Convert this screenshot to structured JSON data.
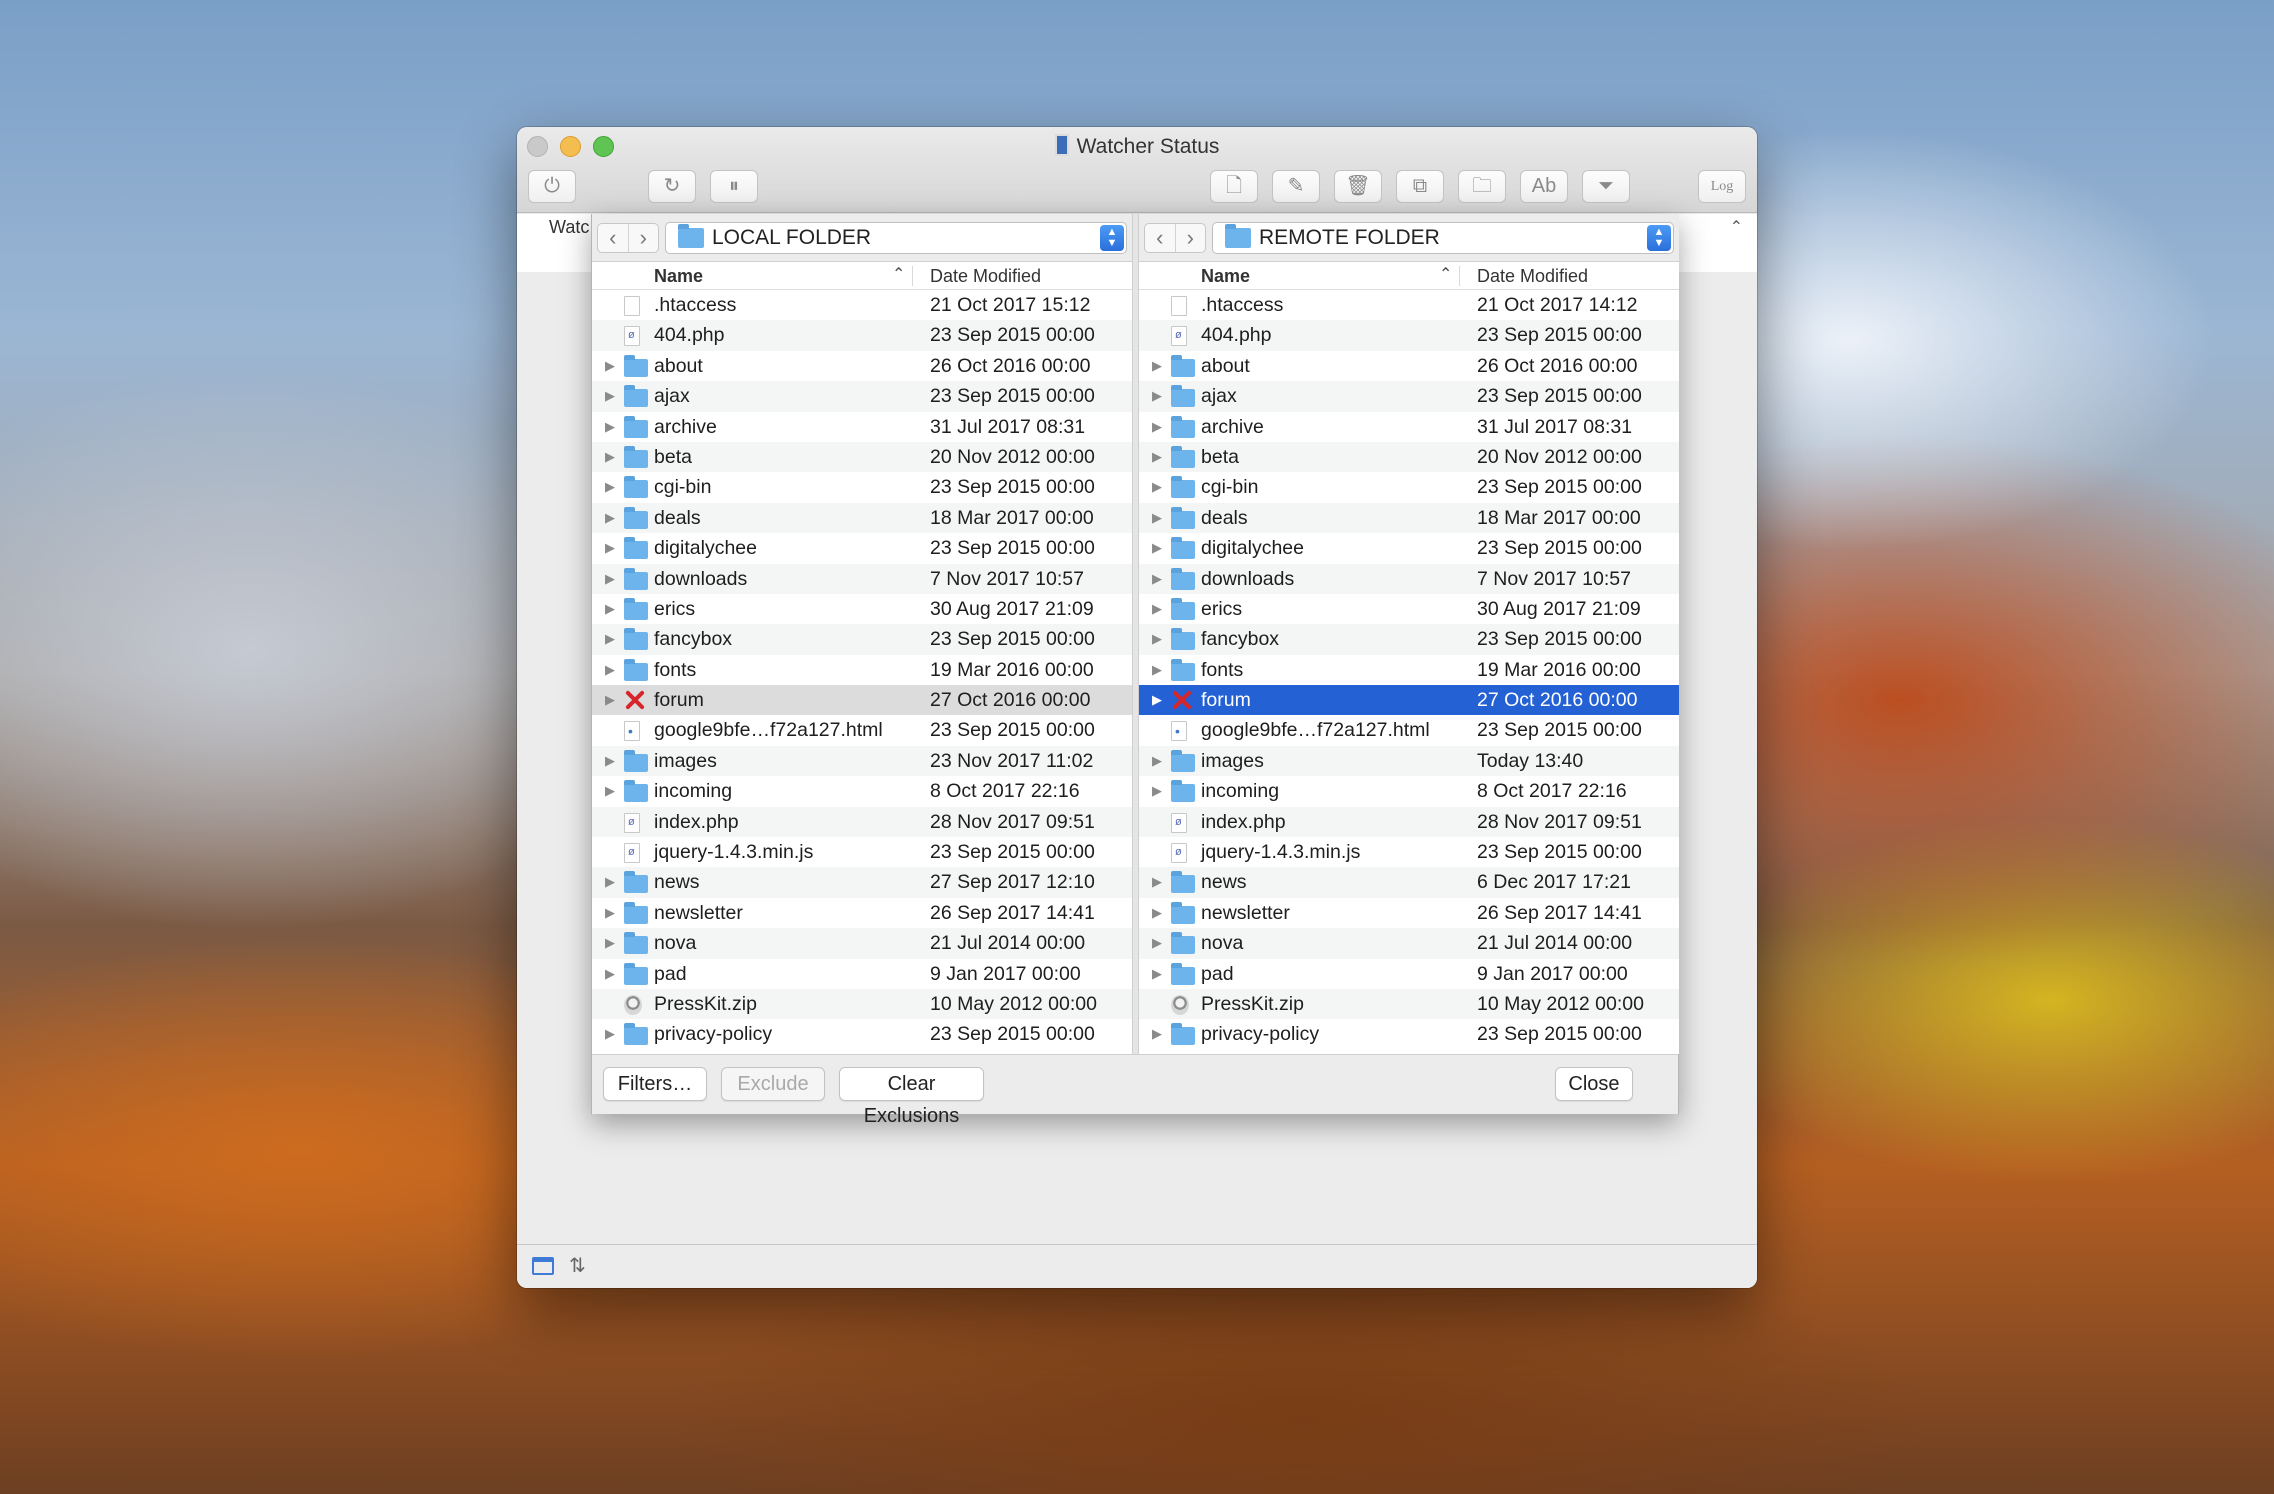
{
  "window": {
    "title": "Watcher Status",
    "watch_label": "Watc"
  },
  "toolbar": {
    "icons": [
      "power-icon",
      "refresh-icon",
      "pause-icon",
      "new-file-icon",
      "edit-icon",
      "trash-icon",
      "copy-icon",
      "new-folder-icon",
      "rename-icon",
      "filter-icon",
      "log-icon"
    ],
    "log_label": "Log"
  },
  "local": {
    "path": "LOCAL FOLDER",
    "columns": {
      "name": "Name",
      "date": "Date Modified"
    },
    "rows": [
      {
        "name": ".htaccess",
        "date": "21 Oct 2017 15:12",
        "kind": "file"
      },
      {
        "name": "404.php",
        "date": "23 Sep 2015 00:00",
        "kind": "php"
      },
      {
        "name": "about",
        "date": "26 Oct 2016 00:00",
        "kind": "folder"
      },
      {
        "name": "ajax",
        "date": "23 Sep 2015 00:00",
        "kind": "folder"
      },
      {
        "name": "archive",
        "date": "31 Jul 2017 08:31",
        "kind": "folder"
      },
      {
        "name": "beta",
        "date": "20 Nov 2012 00:00",
        "kind": "folder"
      },
      {
        "name": "cgi-bin",
        "date": "23 Sep 2015 00:00",
        "kind": "folder"
      },
      {
        "name": "deals",
        "date": "18 Mar 2017 00:00",
        "kind": "folder"
      },
      {
        "name": "digitalychee",
        "date": "23 Sep 2015 00:00",
        "kind": "folder"
      },
      {
        "name": "downloads",
        "date": "7 Nov 2017 10:57",
        "kind": "folder"
      },
      {
        "name": "erics",
        "date": "30 Aug 2017 21:09",
        "kind": "folder"
      },
      {
        "name": "fancybox",
        "date": "23 Sep 2015 00:00",
        "kind": "folder"
      },
      {
        "name": "fonts",
        "date": "19 Mar 2016 00:00",
        "kind": "folder"
      },
      {
        "name": "forum",
        "date": "27 Oct 2016 00:00",
        "kind": "excluded",
        "selected": "gray"
      },
      {
        "name": "google9bfe…f72a127.html",
        "date": "23 Sep 2015 00:00",
        "kind": "html"
      },
      {
        "name": "images",
        "date": "23 Nov 2017 11:02",
        "kind": "folder"
      },
      {
        "name": "incoming",
        "date": "8 Oct 2017 22:16",
        "kind": "folder"
      },
      {
        "name": "index.php",
        "date": "28 Nov 2017 09:51",
        "kind": "php"
      },
      {
        "name": "jquery-1.4.3.min.js",
        "date": "23 Sep 2015 00:00",
        "kind": "php"
      },
      {
        "name": "news",
        "date": "27 Sep 2017 12:10",
        "kind": "folder"
      },
      {
        "name": "newsletter",
        "date": "26 Sep 2017 14:41",
        "kind": "folder"
      },
      {
        "name": "nova",
        "date": "21 Jul 2014 00:00",
        "kind": "folder"
      },
      {
        "name": "pad",
        "date": "9 Jan 2017 00:00",
        "kind": "folder"
      },
      {
        "name": "PressKit.zip",
        "date": "10 May 2012 00:00",
        "kind": "zip"
      },
      {
        "name": "privacy-policy",
        "date": "23 Sep 2015 00:00",
        "kind": "folder"
      }
    ]
  },
  "remote": {
    "path": "REMOTE FOLDER",
    "columns": {
      "name": "Name",
      "date": "Date Modified"
    },
    "rows": [
      {
        "name": ".htaccess",
        "date": "21 Oct 2017 14:12",
        "kind": "file"
      },
      {
        "name": "404.php",
        "date": "23 Sep 2015 00:00",
        "kind": "php"
      },
      {
        "name": "about",
        "date": "26 Oct 2016 00:00",
        "kind": "folder"
      },
      {
        "name": "ajax",
        "date": "23 Sep 2015 00:00",
        "kind": "folder"
      },
      {
        "name": "archive",
        "date": "31 Jul 2017 08:31",
        "kind": "folder"
      },
      {
        "name": "beta",
        "date": "20 Nov 2012 00:00",
        "kind": "folder"
      },
      {
        "name": "cgi-bin",
        "date": "23 Sep 2015 00:00",
        "kind": "folder"
      },
      {
        "name": "deals",
        "date": "18 Mar 2017 00:00",
        "kind": "folder"
      },
      {
        "name": "digitalychee",
        "date": "23 Sep 2015 00:00",
        "kind": "folder"
      },
      {
        "name": "downloads",
        "date": "7 Nov 2017 10:57",
        "kind": "folder"
      },
      {
        "name": "erics",
        "date": "30 Aug 2017 21:09",
        "kind": "folder"
      },
      {
        "name": "fancybox",
        "date": "23 Sep 2015 00:00",
        "kind": "folder"
      },
      {
        "name": "fonts",
        "date": "19 Mar 2016 00:00",
        "kind": "folder"
      },
      {
        "name": "forum",
        "date": "27 Oct 2016 00:00",
        "kind": "excluded",
        "selected": "blue"
      },
      {
        "name": "google9bfe…f72a127.html",
        "date": "23 Sep 2015 00:00",
        "kind": "html"
      },
      {
        "name": "images",
        "date": "Today 13:40",
        "kind": "folder"
      },
      {
        "name": "incoming",
        "date": "8 Oct 2017 22:16",
        "kind": "folder"
      },
      {
        "name": "index.php",
        "date": "28 Nov 2017 09:51",
        "kind": "php"
      },
      {
        "name": "jquery-1.4.3.min.js",
        "date": "23 Sep 2015 00:00",
        "kind": "php"
      },
      {
        "name": "news",
        "date": "6 Dec 2017 17:21",
        "kind": "folder"
      },
      {
        "name": "newsletter",
        "date": "26 Sep 2017 14:41",
        "kind": "folder"
      },
      {
        "name": "nova",
        "date": "21 Jul 2014 00:00",
        "kind": "folder"
      },
      {
        "name": "pad",
        "date": "9 Jan 2017 00:00",
        "kind": "folder"
      },
      {
        "name": "PressKit.zip",
        "date": "10 May 2012 00:00",
        "kind": "zip"
      },
      {
        "name": "privacy-policy",
        "date": "23 Sep 2015 00:00",
        "kind": "folder"
      }
    ]
  },
  "footer": {
    "filters": "Filters…",
    "exclude": "Exclude",
    "clear": "Clear Exclusions",
    "close": "Close"
  },
  "colors": {
    "selection": "#2461d4",
    "exclude_mark": "#d6262b",
    "folder": "#6db4ec"
  }
}
